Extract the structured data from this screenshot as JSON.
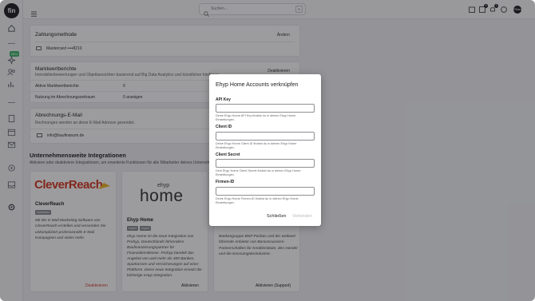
{
  "app": {
    "logo_text": "fin"
  },
  "sidebar": {
    "new_badge": "NEU"
  },
  "header": {
    "search_placeholder": "Suchen...",
    "search_shortcut": "S",
    "badge_1": "4",
    "badge_2": "1",
    "avatar_text": "FiNance"
  },
  "payment": {
    "title": "Zahlungsmethode",
    "action": "Ändern",
    "card_text": "Mastercard ••••8210"
  },
  "reports": {
    "title": "Marktwertberichte",
    "subtitle": "Immobilienbewertungen und Objektansichten basierend auf Big Data Analytics und künstlicher Intelligenz",
    "action": "Deaktivieren",
    "rows": [
      {
        "label": "Aktive Marktwertberichte",
        "value": "0"
      },
      {
        "label": "Nutzung im Abrechnungszeitraum",
        "value": "0 anzeigen"
      }
    ]
  },
  "billing_email": {
    "title": "Abrechnungs-E-Mail",
    "subtitle": "Rechnungen werden an diese E-Mail Adresse gesendet.",
    "email": "info@baufinanum.de"
  },
  "integrations": {
    "title": "Unternehmensweite Integrationen",
    "subtitle": "Aktiviere oder deaktiviere Integrationen, um erweiterte Funktionen für alle Mitarbeiter deines Unternehmens",
    "cards": [
      {
        "logo": "CleverReach",
        "name": "CleverReach",
        "tags": [
          "newsletter"
        ],
        "description": "Mit der E-Mail-Marketing Software von CleverReach erstellen und versenden Sie unkompliziert professionelle E-Mail Kampagnen und vieles mehr.",
        "action": "Deaktivieren"
      },
      {
        "logo_small": "ehyp",
        "logo_big": "home",
        "name": "Ehyp Home",
        "tags": [
          "import",
          "export"
        ],
        "description": "ehyp Home ist die neue Integration von Prohyp, Deutschlands führendem Baufinanzierungspartner für Finanzdienstleister. Prohyp bündelt das Angebot von weit mehr als 400 Banken, Sparkassen und Versicherungen auf einer Plattform. Diese neue Integration ersetzt die bisherige eHyp Integration.",
        "action": "Aktivieren"
      },
      {
        "description": "Bankengruppe BNP Paribas und der weltweit führende Anbieter von Bancassurance-Partnerschaften für Kreditinstitute, den Handel und die Konsumgüterindustrie.",
        "action": "Aktivieren (Support)"
      }
    ]
  },
  "modal": {
    "title": "Ehyp Home Accounts verknüpfen",
    "fields": [
      {
        "label": "API Key",
        "help": "Deine Ehyp Home API Key findest du in deinen Ehyp Home Einstellungen."
      },
      {
        "label": "Client ID",
        "help": "Deine Ehyp Home Client ID findest du in deinen Ehyp Home Einstellungen."
      },
      {
        "label": "Client Secret",
        "help": "Dein Ehyp Home Client Secret findest du in deinen Ehyp Home Einstellungen."
      },
      {
        "label": "Firmen-ID",
        "help": "Deine Ehyp Home Firmen-ID findest du in deinen Ehyp Home Einstellungen."
      }
    ],
    "close_label": "Schließen",
    "connect_label": "Verbinden"
  }
}
